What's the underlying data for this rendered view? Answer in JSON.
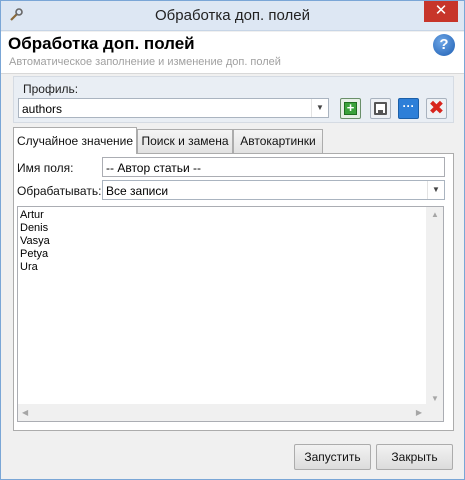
{
  "window": {
    "title": "Обработка доп. полей",
    "close_glyph": "✕",
    "app_icon": "tool-icon",
    "colors": {
      "close_button": "#c7352a",
      "accent": "#2d7fd8"
    }
  },
  "header": {
    "title": "Обработка доп. полей",
    "subtitle": "Автоматическое заполнение и изменение доп. полей",
    "help_glyph": "?"
  },
  "profile": {
    "label": "Профиль:",
    "value": "authors",
    "buttons": [
      {
        "name": "add-profile",
        "icon": "add-icon",
        "glyph": "+"
      },
      {
        "name": "save-profile",
        "icon": "save-icon"
      },
      {
        "name": "profile-menu",
        "icon": "more-icon",
        "glyph": "···"
      },
      {
        "name": "delete-profile",
        "icon": "delete-icon",
        "glyph": "✖"
      }
    ]
  },
  "tabs": [
    {
      "label": "Случайное значение",
      "active": true
    },
    {
      "label": "Поиск и замена",
      "active": false
    },
    {
      "label": "Автокартинки",
      "active": false
    }
  ],
  "form": {
    "field_name_label": "Имя поля:",
    "field_name_value": "-- Автор статьи --",
    "process_label": "Обрабатывать:",
    "process_value": "Все записи",
    "values": [
      "Artur",
      "Denis",
      "Vasya",
      "Petya",
      "Ura"
    ]
  },
  "buttons": {
    "run": "Запустить",
    "close": "Закрыть"
  }
}
